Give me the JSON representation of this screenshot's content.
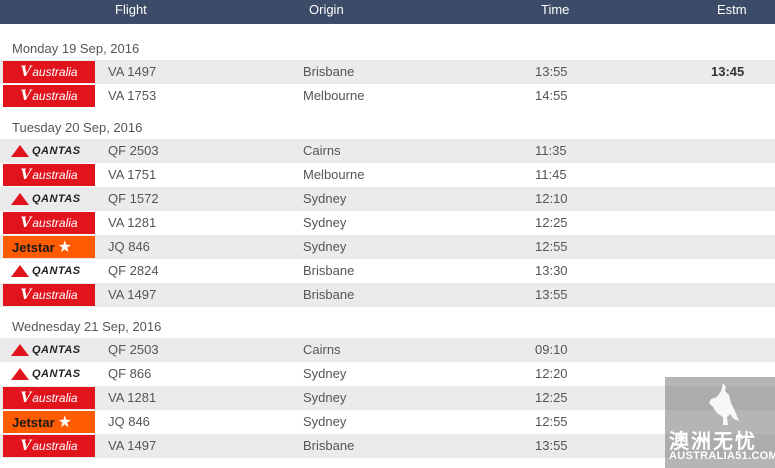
{
  "header": {
    "flight": "Flight",
    "origin": "Origin",
    "time": "Time",
    "estm": "Estm"
  },
  "groups": [
    {
      "date": "Monday 19 Sep, 2016",
      "rows": [
        {
          "airline": "virgin",
          "flight": "VA 1497",
          "origin": "Brisbane",
          "time": "13:55",
          "estm": "13:45"
        },
        {
          "airline": "virgin",
          "flight": "VA 1753",
          "origin": "Melbourne",
          "time": "14:55",
          "estm": ""
        }
      ]
    },
    {
      "date": "Tuesday 20 Sep, 2016",
      "rows": [
        {
          "airline": "qantas",
          "flight": "QF 2503",
          "origin": "Cairns",
          "time": "11:35",
          "estm": ""
        },
        {
          "airline": "virgin",
          "flight": "VA 1751",
          "origin": "Melbourne",
          "time": "11:45",
          "estm": ""
        },
        {
          "airline": "qantas",
          "flight": "QF 1572",
          "origin": "Sydney",
          "time": "12:10",
          "estm": ""
        },
        {
          "airline": "virgin",
          "flight": "VA 1281",
          "origin": "Sydney",
          "time": "12:25",
          "estm": ""
        },
        {
          "airline": "jetstar",
          "flight": "JQ 846",
          "origin": "Sydney",
          "time": "12:55",
          "estm": ""
        },
        {
          "airline": "qantas",
          "flight": "QF 2824",
          "origin": "Brisbane",
          "time": "13:30",
          "estm": ""
        },
        {
          "airline": "virgin",
          "flight": "VA 1497",
          "origin": "Brisbane",
          "time": "13:55",
          "estm": ""
        }
      ]
    },
    {
      "date": "Wednesday 21 Sep, 2016",
      "rows": [
        {
          "airline": "qantas",
          "flight": "QF 2503",
          "origin": "Cairns",
          "time": "09:10",
          "estm": ""
        },
        {
          "airline": "qantas",
          "flight": "QF 866",
          "origin": "Sydney",
          "time": "12:20",
          "estm": ""
        },
        {
          "airline": "virgin",
          "flight": "VA 1281",
          "origin": "Sydney",
          "time": "12:25",
          "estm": ""
        },
        {
          "airline": "jetstar",
          "flight": "JQ 846",
          "origin": "Sydney",
          "time": "12:55",
          "estm": ""
        },
        {
          "airline": "virgin",
          "flight": "VA 1497",
          "origin": "Brisbane",
          "time": "13:55",
          "estm": ""
        }
      ]
    }
  ],
  "logos": {
    "virgin": {
      "text": "australia",
      "mark": "V",
      "color": "#e1141e"
    },
    "qantas": {
      "text": "QANTAS",
      "color": "#e1141e"
    },
    "jetstar": {
      "text": "Jetstar",
      "color": "#ff5b00"
    }
  },
  "watermark": {
    "cn": "澳洲无忧",
    "en": "AUSTRALIA51.COM",
    "icon": "kangaroo-icon"
  }
}
